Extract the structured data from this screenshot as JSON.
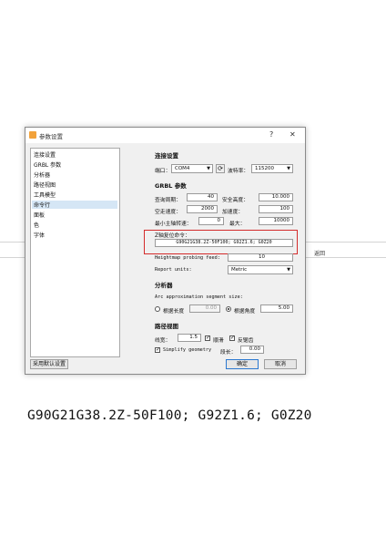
{
  "background": {
    "right_label": "返回",
    "caption": "G90G21G38.2Z-50F100; G92Z1.6; G0Z20"
  },
  "dialog": {
    "title": "参数设置",
    "help_btn": "?",
    "close_btn": "✕",
    "sidebar": {
      "items": [
        "连接设置",
        "GRBL 参数",
        "分析器",
        "路径视图",
        "工具模型",
        "命令行",
        "面板",
        "色",
        "字体"
      ],
      "selected_index": 5
    },
    "connection": {
      "header": "连接设置",
      "port_label": "端口：",
      "port_value": "COM4",
      "refresh_icon": "refresh-icon",
      "baud_label": "波特率：",
      "baud_value": "115200"
    },
    "grbl": {
      "header": "GRBL 参数",
      "query_period_label": "查询周期：",
      "query_period_value": "40",
      "safe_height_label": "安全高度：",
      "safe_height_value": "10.000",
      "rapid_speed_label": "空走速度：",
      "rapid_speed_value": "2000",
      "accel_label": "加速度：",
      "accel_value": "100",
      "min_spindle_label": "最小主轴转速：",
      "min_spindle_value": "0",
      "max_label": "最大：",
      "max_value": "10000",
      "zero_cmd_label": "Z轴复位命令：",
      "zero_cmd_value": "G90G21G38.2Z-50F100; G92Z1.6; G0Z20",
      "probe_feed_label": "Heightmap probing feed:",
      "probe_feed_value": "10",
      "units_label": "Report units:",
      "units_value": "Metric"
    },
    "parser": {
      "header": "分析器",
      "arc_label": "Arc approximation segment size:",
      "by_length_label": "根据长度",
      "by_length_value": "0.00",
      "by_angle_label": "根据角度",
      "by_angle_value": "5.00"
    },
    "path_view": {
      "header": "路径视图",
      "line_width_label": "线宽：",
      "line_width_value": "1.5",
      "smooth_label": "顺滑",
      "antialias_label": "反锯齿",
      "simplify_label": "Simplify geometry",
      "precision_label": "段长：",
      "precision_value": "0.00"
    },
    "buttons": {
      "defaults": "采用默认设置",
      "ok": "确定",
      "cancel": "取消"
    }
  }
}
